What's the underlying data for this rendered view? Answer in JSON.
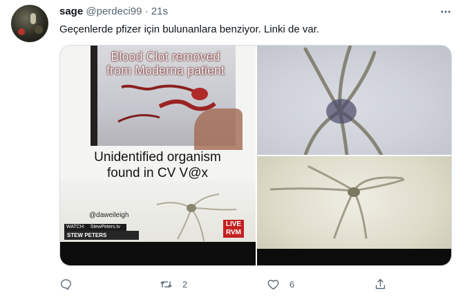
{
  "tweet": {
    "author_name": "sage",
    "author_handle": "@perdeci99",
    "separator": "·",
    "time": "21s",
    "text": "Geçenlerde pfizer için bulunanlara benziyor. Linki de var."
  },
  "media": {
    "left_image": {
      "caption_top_line1": "Blood Clot removed",
      "caption_top_line2": "from Moderna patient",
      "caption_mid_line1": "Unidentified organism",
      "caption_mid_line2": "found in CV V@x",
      "credit": "@daweileigh",
      "watch_label": "WATCH:",
      "watch_sub": "StewPeters.tv",
      "show_name": "STEW PETERS",
      "badge_top": "LIVE",
      "badge_bottom": "RVM"
    }
  },
  "actions": {
    "reply_count": "",
    "retweet_count": "2",
    "like_count": "6"
  },
  "icons": {
    "reply": "reply-icon",
    "retweet": "retweet-icon",
    "like": "heart-icon",
    "share": "share-icon",
    "more": "more-icon"
  },
  "colors": {
    "text_primary": "#0f1419",
    "text_secondary": "#536471",
    "border": "#cfd9de"
  }
}
